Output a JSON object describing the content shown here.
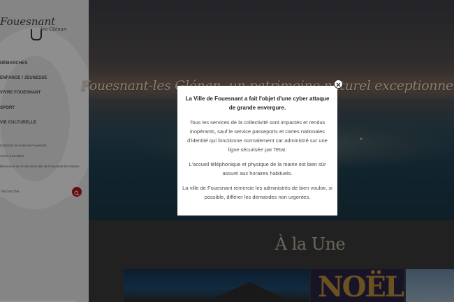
{
  "logo": {
    "main": "Fouesnant",
    "sub": "les Glénan"
  },
  "nav": {
    "items": [
      {
        "label": "DÉMARCHES"
      },
      {
        "label": "ENFANCE / JEUNESSE"
      },
      {
        "label": "VIVRE FOUESNANT"
      },
      {
        "label": "SPORT"
      },
      {
        "label": "VIE CULTURELLE"
      }
    ]
  },
  "small_links": [
    "Contacter la mairie de Fouesnant",
    "Accès à la mairie",
    "Bienvenue sur le site de la ville de Fouesnant-les Glénan"
  ],
  "search": {
    "placeholder": "Rechercher"
  },
  "hero": {
    "text": "Fouesnant-les Glénan, un patrimoine naturel exceptionnel"
  },
  "section": {
    "title": "À la Une"
  },
  "cards": [
    {
      "label": ""
    },
    {
      "label": "NOËL"
    },
    {
      "label": ""
    }
  ],
  "modal": {
    "title": "La Ville de Fouesnant a fait l'objet d'une cyber attaque de grande envergure.",
    "paragraphs": [
      "Tous les services de la collectivité sont impactés et rendus inopérants, sauf le service passeports et cartes nationales d'identité qui fonctionne normalement car administré sur une ligne sécurisée par l'Etat.",
      "L'accueil téléphonique et physique de la mairie est bien sûr assuré aux horaires habituels.",
      "La ville de Fouesnant remercie les administrés de bien vouloir, si possible, différer les demandes non urgentes."
    ]
  },
  "colors": {
    "accent": "#b0141d",
    "overlay": "#000000",
    "sidebar_bg": "#e6e6e6"
  }
}
